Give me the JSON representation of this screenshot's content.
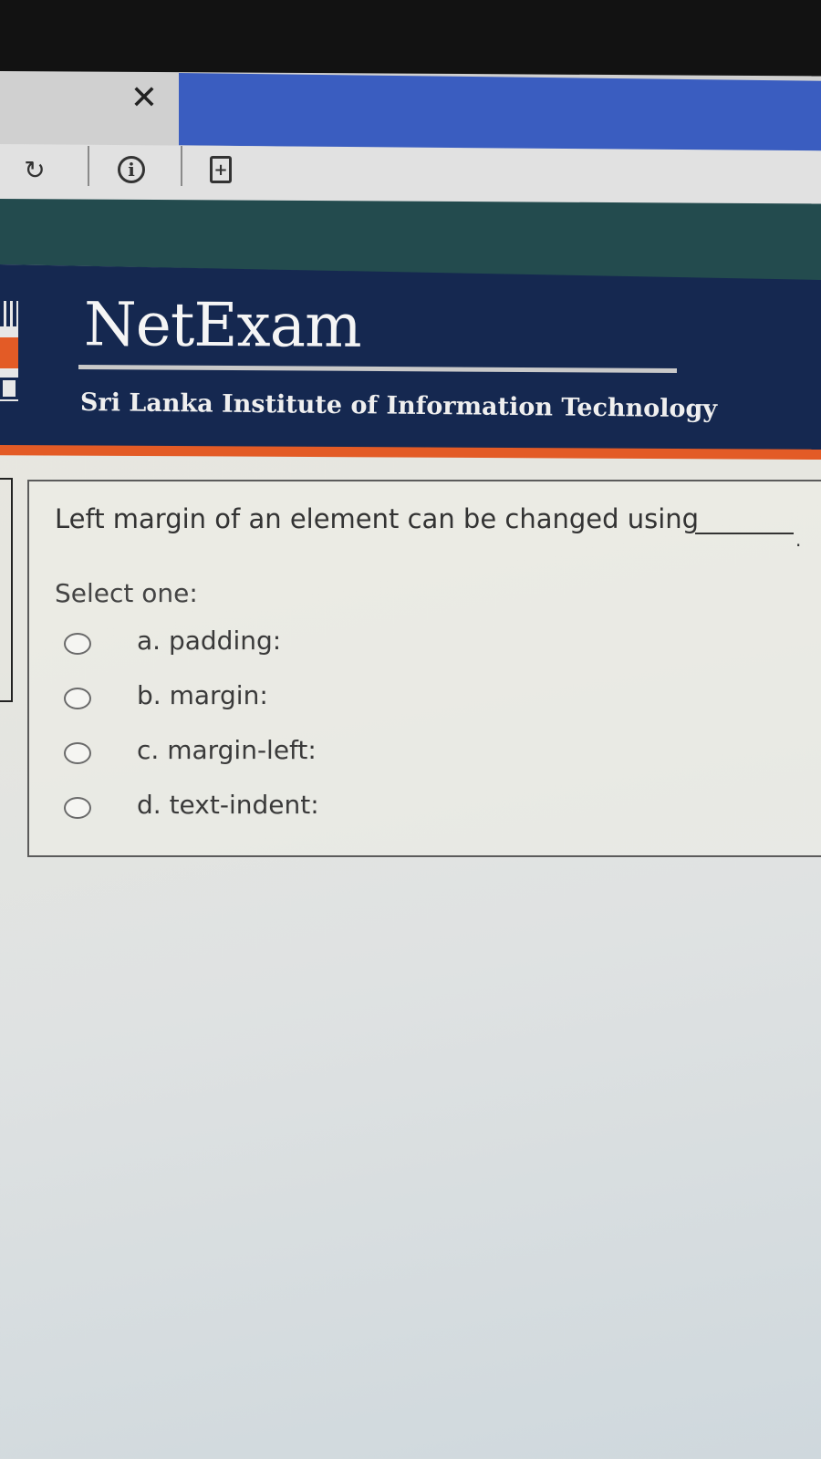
{
  "browser": {
    "tab_close_icon": "close-icon",
    "toolbar_icons": [
      "reload-icon",
      "info-icon",
      "add-page-icon"
    ]
  },
  "header": {
    "brand": "NetExam",
    "institution": "Sri Lanka Institute of Information Technology"
  },
  "question": {
    "text": "Left margin of an element can be changed using",
    "blank_suffix": ".",
    "prompt": "Select one:",
    "options": [
      {
        "label": "a. padding:"
      },
      {
        "label": "b. margin:"
      },
      {
        "label": "c. margin-left:"
      },
      {
        "label": "d. text-indent:"
      }
    ]
  },
  "colors": {
    "header_bg": "#152850",
    "accent_orange": "#e35b26",
    "tab_blue": "#3a5dc0",
    "teal": "#234b4e"
  }
}
